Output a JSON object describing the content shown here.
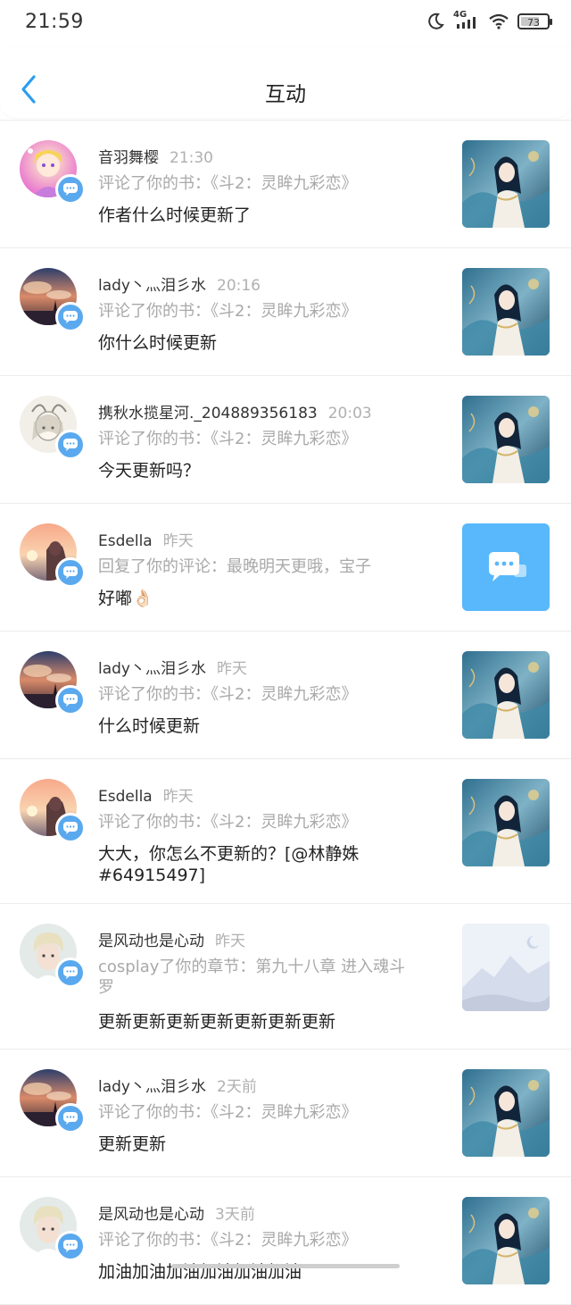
{
  "status_bar": {
    "time": "21:59",
    "network": "4G",
    "battery": "73",
    "battery_level": 0.73
  },
  "header": {
    "title": "互动"
  },
  "items": [
    {
      "username": "音羽舞樱",
      "time": "21:30",
      "action": "评论了你的书：《斗2：灵眸九彩恋》",
      "content": "作者什么时候更新了",
      "avatar_icon": "anime-girl-avatar",
      "thumb_icon": "book-cover"
    },
    {
      "username": "lady丶灬泪彡水",
      "time": "20:16",
      "action": "评论了你的书：《斗2：灵眸九彩恋》",
      "content": "你什么时候更新",
      "avatar_icon": "sunset-sky-avatar",
      "thumb_icon": "book-cover"
    },
    {
      "username": "携秋水揽星河._204889356183",
      "time": "20:03",
      "action": "评论了你的书：《斗2：灵眸九彩恋》",
      "content": "今天更新吗？",
      "avatar_icon": "sketch-girl-avatar",
      "thumb_icon": "book-cover"
    },
    {
      "username": "Esdella",
      "time": "昨天",
      "action": "回复了你的评论：最晚明天更哦，宝子",
      "content": "好嘟👌🏻",
      "avatar_icon": "sunset-girl-avatar",
      "thumb_icon": "chat-bubble"
    },
    {
      "username": "lady丶灬泪彡水",
      "time": "昨天",
      "action": "评论了你的书：《斗2：灵眸九彩恋》",
      "content": "什么时候更新",
      "avatar_icon": "sunset-sky-avatar",
      "thumb_icon": "book-cover"
    },
    {
      "username": "Esdella",
      "time": "昨天",
      "action": "评论了你的书：《斗2：灵眸九彩恋》",
      "content": "大大，你怎么不更新的？[@林静姝 #64915497]",
      "avatar_icon": "sunset-girl-avatar",
      "thumb_icon": "book-cover"
    },
    {
      "username": "是风动也是心动",
      "time": "昨天",
      "action": "cosplay了你的章节：第九十八章 进入魂斗罗",
      "content": "更新更新更新更新更新更新更新",
      "avatar_icon": "blond-boy-avatar",
      "thumb_icon": "placeholder-landscape"
    },
    {
      "username": "lady丶灬泪彡水",
      "time": "2天前",
      "action": "评论了你的书：《斗2：灵眸九彩恋》",
      "content": "更新更新",
      "avatar_icon": "sunset-sky-avatar",
      "thumb_icon": "book-cover"
    },
    {
      "username": "是风动也是心动",
      "time": "3天前",
      "action": "评论了你的书：《斗2：灵眸九彩恋》",
      "content": "加油加油加油加油加油加油",
      "avatar_icon": "blond-boy-avatar",
      "thumb_icon": "book-cover"
    }
  ]
}
